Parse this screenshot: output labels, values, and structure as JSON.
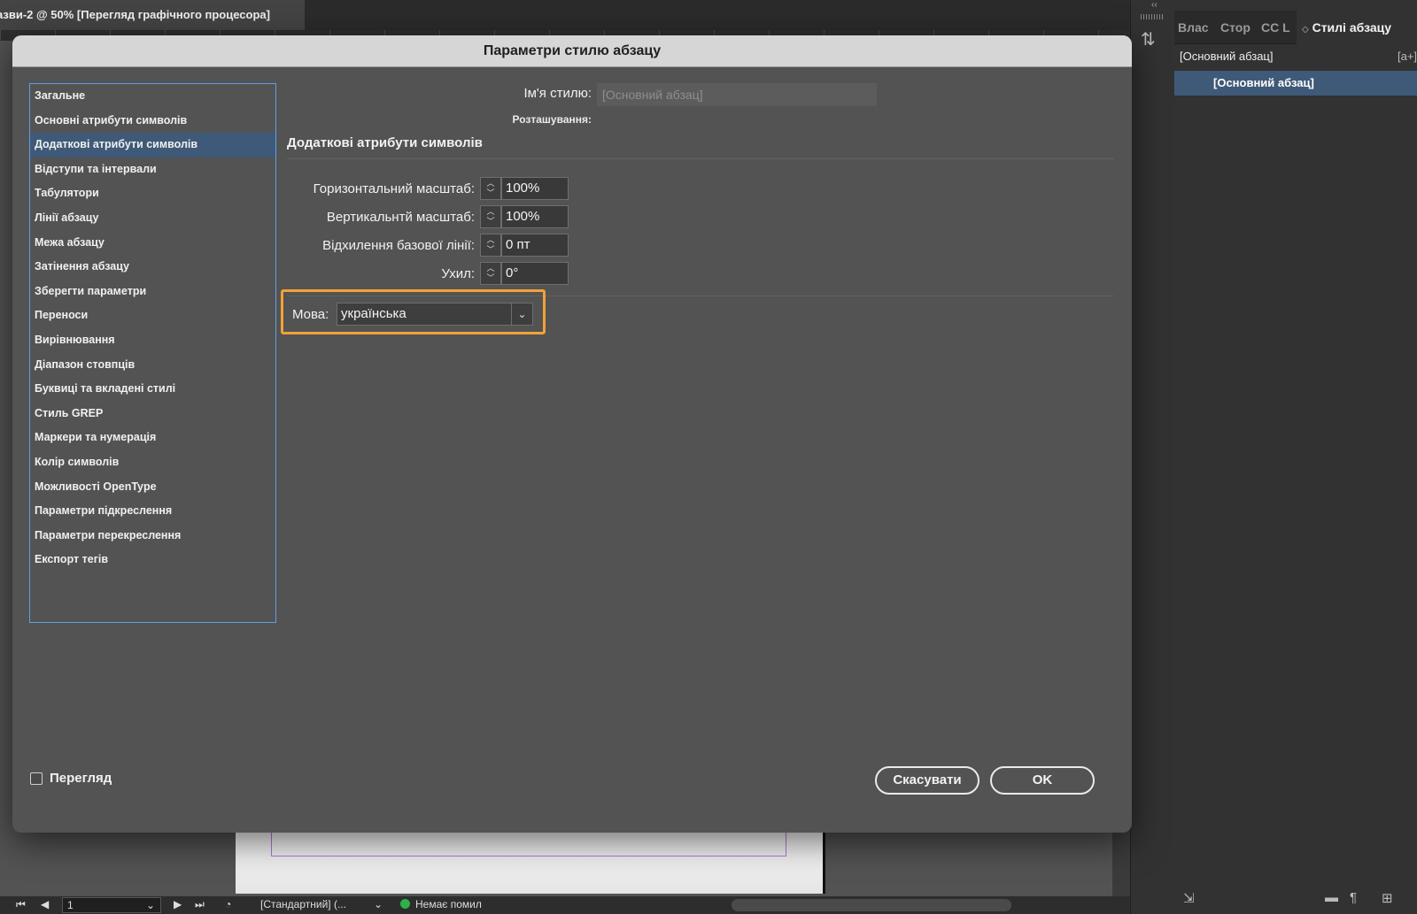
{
  "document": {
    "tab_title": "азви-2 @ 50% [Перегляд графічного процесора]"
  },
  "panel": {
    "collapse": "‹‹",
    "tabs": [
      "Влас",
      "Стор",
      "CC L",
      "Стилі абзацу"
    ],
    "active_tab_marker": "◇",
    "current_style": "[Основний абзац]",
    "new_style_icon": "[a+]",
    "styles": [
      "[Основний абзац]"
    ]
  },
  "dialog": {
    "title": "Параметри стилю абзацу",
    "categories": [
      "Загальне",
      "Основні атрибути символів",
      "Додаткові атрибути символів",
      "Відступи та інтервали",
      "Табулятори",
      "Лінії абзацу",
      "Межа абзацу",
      "Затінення абзацу",
      "Зберегти параметри",
      "Переноси",
      "Вирівнювання",
      "Діапазон стовпців",
      "Буквиці та вкладені стилі",
      "Стиль GREP",
      "Маркери та нумерація",
      "Колір символів",
      "Можливості OpenType",
      "Параметри підкреслення",
      "Параметри перекреслення",
      "Експорт тегів"
    ],
    "selected_category_index": 2,
    "style_name_label": "Ім'я стилю:",
    "style_name_value": "[Основний абзац]",
    "location_label": "Розташування:",
    "section_title": "Додаткові атрибути символів",
    "fields": {
      "horizontal_scale": {
        "label": "Горизонтальний масштаб:",
        "value": "100%"
      },
      "vertical_scale": {
        "label": "Вертикальнтй масштаб:",
        "value": "100%"
      },
      "baseline_shift": {
        "label": "Відхилення базової лінії:",
        "value": "0 пт"
      },
      "skew": {
        "label": "Ухил:",
        "value": "0°"
      }
    },
    "language": {
      "label": "Мова:",
      "value": "українська"
    },
    "preview_label": "Перегляд",
    "preview_checked": false,
    "cancel_label": "Скасувати",
    "ok_label": "OK"
  },
  "statusbar": {
    "page_number": "1",
    "profile": "[Стандартний] (...",
    "preflight": "Немає помил"
  },
  "colors": {
    "highlight": "#f2a13a",
    "selection": "#3f5a78",
    "focus_border": "#5aa0e6",
    "preflight_ok": "#2fb14a"
  }
}
